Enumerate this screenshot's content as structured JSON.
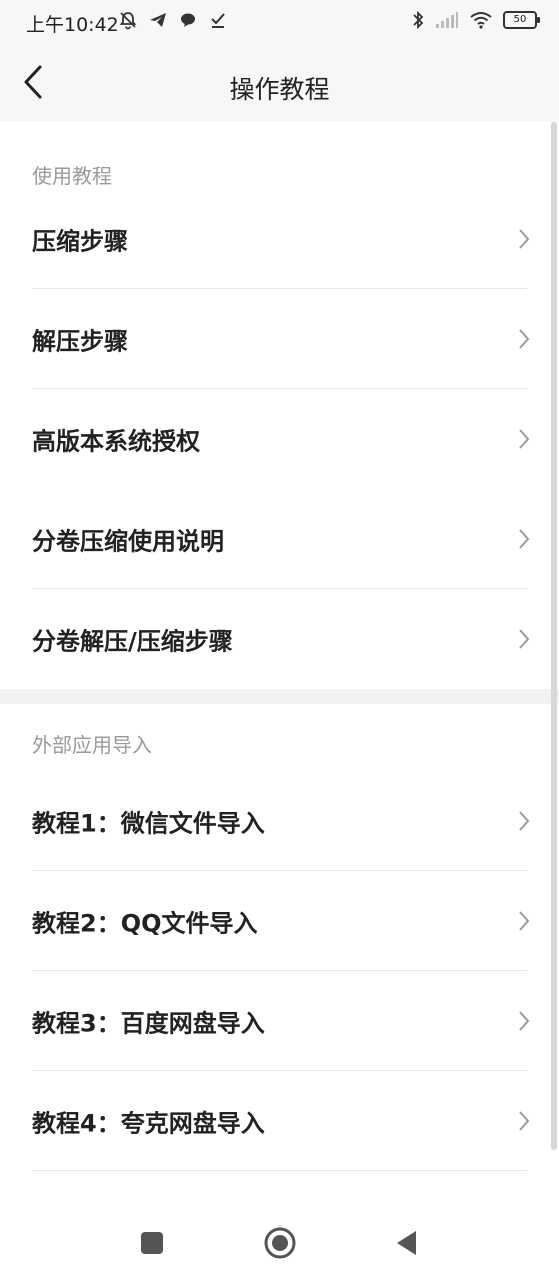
{
  "status_bar": {
    "time": "上午10:42",
    "battery": "50",
    "icons": [
      "bell-off-icon",
      "telegram-icon",
      "chat-bubble-icon",
      "download-done-icon",
      "bluetooth-icon",
      "signal-icon",
      "wifi-icon",
      "battery-icon"
    ]
  },
  "appbar": {
    "title": "操作教程",
    "back_icon": "chevron-left-icon"
  },
  "sections": [
    {
      "header": "使用教程",
      "items": [
        {
          "label": "压缩步骤"
        },
        {
          "label": "解压步骤"
        },
        {
          "label": "高版本系统授权"
        },
        {
          "label": "分卷压缩使用说明"
        },
        {
          "label": "分卷解压/压缩步骤"
        }
      ]
    },
    {
      "header": "外部应用导入",
      "items": [
        {
          "label": "教程1：微信文件导入"
        },
        {
          "label": "教程2：QQ文件导入"
        },
        {
          "label": "教程3：百度网盘导入"
        },
        {
          "label": "教程4：夸克网盘导入"
        }
      ]
    }
  ],
  "nav_bar": {
    "icons": [
      "recents-square-icon",
      "home-circle-icon",
      "back-triangle-icon"
    ]
  }
}
